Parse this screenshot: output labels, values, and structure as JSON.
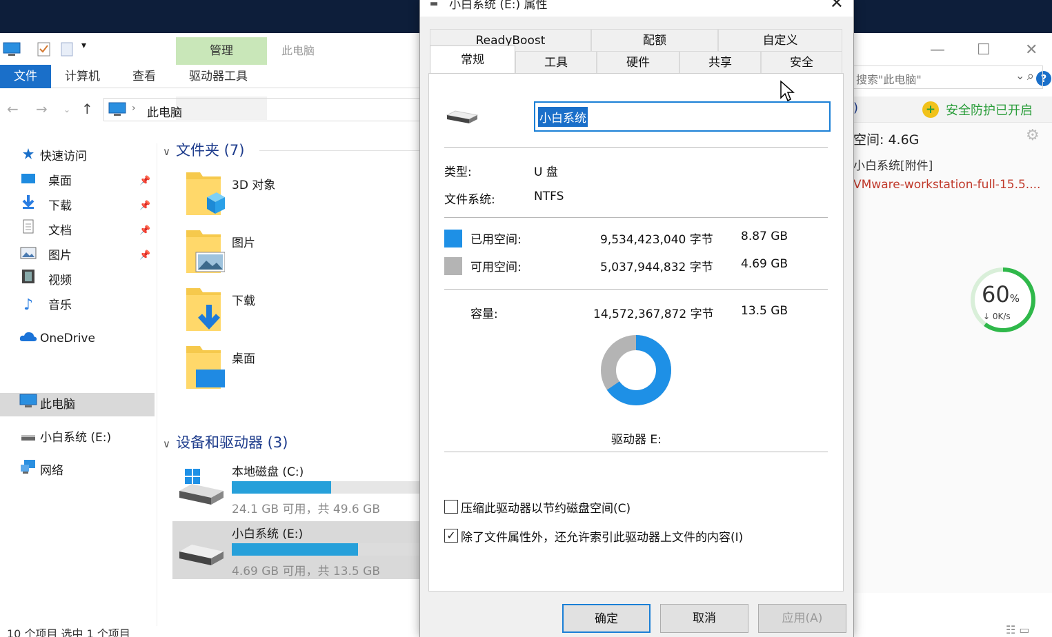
{
  "explorer": {
    "ribbon": {
      "tabs": [
        "文件",
        "计算机",
        "查看",
        "驱动器工具"
      ],
      "context_group": "管理",
      "context_title": "此电脑"
    },
    "address": {
      "path": "此电脑"
    },
    "search": {
      "placeholder": "搜索\"此电脑\""
    },
    "sidebar": [
      {
        "label": "快速访问",
        "icon": "star-icon"
      },
      {
        "label": "桌面",
        "icon": "desktop-icon",
        "pinned": true
      },
      {
        "label": "下载",
        "icon": "download-arrow-icon",
        "pinned": true
      },
      {
        "label": "文档",
        "icon": "document-icon",
        "pinned": true
      },
      {
        "label": "图片",
        "icon": "picture-icon",
        "pinned": true
      },
      {
        "label": "视频",
        "icon": "film-icon"
      },
      {
        "label": "音乐",
        "icon": "music-note-icon"
      },
      {
        "label": "OneDrive",
        "icon": "cloud-icon"
      },
      {
        "label": "此电脑",
        "icon": "computer-icon",
        "selected": true
      },
      {
        "label": "小白系统 (E:)",
        "icon": "usb-drive-icon"
      },
      {
        "label": "网络",
        "icon": "network-icon"
      }
    ],
    "folders_header": "文件夹 (7)",
    "folders": [
      "3D 对象",
      "图片",
      "下载",
      "桌面"
    ],
    "devices_header": "设备和驱动器 (3)",
    "drives": [
      {
        "label": "本地磁盘 (C:)",
        "info": "24.1 GB 可用，共 49.6 GB",
        "used_fraction": 0.514
      },
      {
        "label": "小白系统 (E:)",
        "info": "4.69 GB 可用，共 13.5 GB",
        "used_fraction": 0.653,
        "selected": true
      }
    ],
    "status": "10 个项目    选中 1 个项目",
    "right_panel": {
      "paren": ")",
      "safe_text": "安全防护已开启",
      "space_text": "空间: 4.6G",
      "attachment": "小白系统[附件]",
      "file_name": "VMware-workstation-full-15.5....",
      "percent": "60",
      "percent_unit": "%",
      "speed": "0K/s"
    }
  },
  "dialog": {
    "title": "小白系统 (E:) 属性",
    "tabs_row1": [
      "ReadyBoost",
      "配额",
      "自定义"
    ],
    "tabs_row2": [
      "常规",
      "工具",
      "硬件",
      "共享",
      "安全"
    ],
    "active_tab": "常规",
    "name_value": "小白系统",
    "type_label": "类型:",
    "type_value": "U 盘",
    "fs_label": "文件系统:",
    "fs_value": "NTFS",
    "used_label": "已用空间:",
    "used_bytes": "9,534,423,040 字节",
    "used_gb": "8.87 GB",
    "free_label": "可用空间:",
    "free_bytes": "5,037,944,832 字节",
    "free_gb": "4.69 GB",
    "cap_label": "容量:",
    "cap_bytes": "14,572,367,872 字节",
    "cap_gb": "13.5 GB",
    "drive_label": "驱动器 E:",
    "used_fraction": 0.654,
    "compress_label": "压缩此驱动器以节约磁盘空间(C)",
    "compress_checked": false,
    "index_label": "除了文件属性外，还允许索引此驱动器上文件的内容(I)",
    "index_checked": true,
    "ok": "确定",
    "cancel": "取消",
    "apply": "应用(A)",
    "colors": {
      "used": "#1e90e6",
      "free": "#b4b4b4",
      "accent": "#1a6fc9"
    }
  }
}
